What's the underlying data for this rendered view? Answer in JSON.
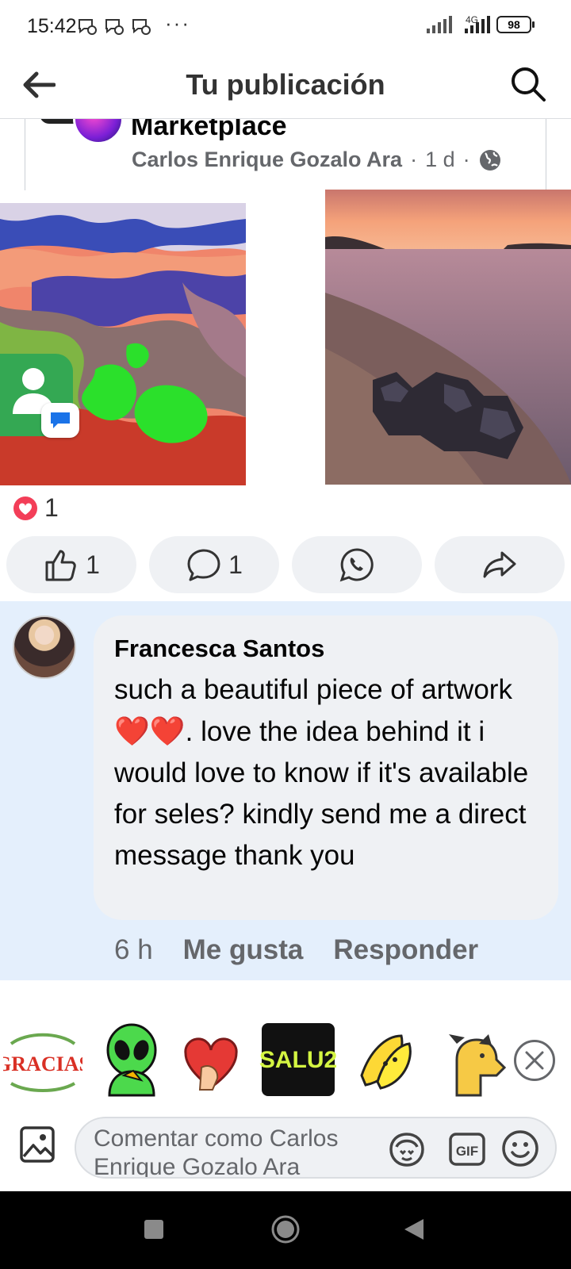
{
  "status_bar": {
    "time": "15:42",
    "more": "···",
    "network": "4G",
    "battery": "98"
  },
  "header": {
    "title": "Tu publicación"
  },
  "shared_post": {
    "group_name": "Marketplace",
    "author": "Carlos Enrique Gozalo Ara",
    "time": "1 d",
    "separator": "·"
  },
  "reactions": {
    "love_count": "1"
  },
  "actions": {
    "like_count": "1",
    "comment_count": "1"
  },
  "comment": {
    "author": "Francesca Santos",
    "text_before": "such a beautiful piece of artwork ",
    "hearts": "❤️❤️",
    "text_after": ". love the idea behind it i would love to know if it's available for seles? kindly send me a direct message thank you",
    "time": "6 h",
    "like_label": "Me gusta",
    "reply_label": "Responder"
  },
  "stickers": [
    "GRACIAS",
    "SALU2"
  ],
  "composer": {
    "placeholder": "Comentar como Carlos Enrique Gozalo Ara",
    "gif_label": "GIF"
  },
  "colors": {
    "comment_highlight": "#e4effc",
    "bubble": "#eff1f4",
    "love_red": "#f33e58",
    "secondary_text": "#65676b"
  }
}
